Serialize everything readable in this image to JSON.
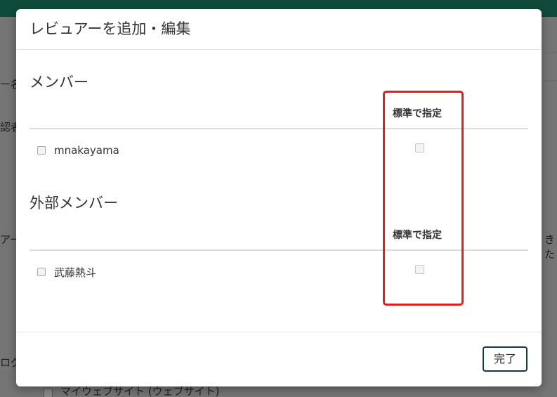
{
  "background": {
    "text_1": "ー名",
    "text_2": "認者",
    "text_3": "アー",
    "text_4": "ログ",
    "right_text_1": "き",
    "right_text_2": "た",
    "bottom_checkbox_label": "マイウェブサイト (ウェブサイト)"
  },
  "modal": {
    "title": "レビュアーを追加・編集",
    "members": {
      "title": "メンバー",
      "default_header": "標準で指定",
      "items": [
        {
          "name": "mnakayama"
        }
      ]
    },
    "external_members": {
      "title": "外部メンバー",
      "default_header": "標準で指定",
      "items": [
        {
          "name": "武藤熱斗"
        }
      ]
    },
    "done_label": "完了"
  },
  "colors": {
    "topbar": "#0f4a3a",
    "highlight": "#e11d1d",
    "button_border": "#123a4c"
  }
}
